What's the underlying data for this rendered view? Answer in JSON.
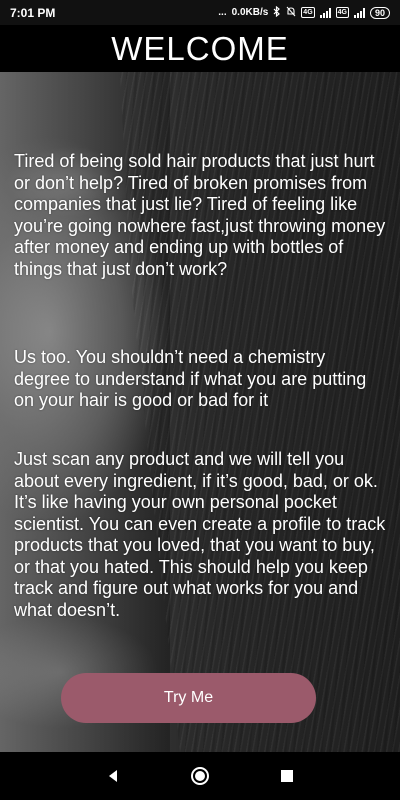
{
  "status_bar": {
    "time": "7:01 PM",
    "dots": "...",
    "network_speed": "0.0KB/s",
    "battery": "90",
    "icons": [
      "bluetooth-icon",
      "mute-bell-icon",
      "volte-icon",
      "signal-icon",
      "signal-icon",
      "battery-icon"
    ]
  },
  "header": {
    "title": "WELCOME"
  },
  "main": {
    "paragraphs": [
      "Tired of being sold hair products that just hurt or don’t help? Tired of broken promises from companies that just lie? Tired of feeling like you’re going nowhere fast,just throwing money after money and ending up with bottles of things that just don’t work?",
      "Us too. You shouldn’t need a chemistry degree to understand if what you are putting on your hair is good or bad for it",
      "Just scan any product and we will tell you about every ingredient, if it’s good, bad, or ok. It’s like having your own personal pocket scientist. You can even create a profile to track products that you loved, that you want to buy, or that you hated. This should help you keep track and figure out what works for you and what doesn’t."
    ],
    "try_button_label": "Try Me",
    "button_color": "#9b5a6b"
  },
  "nav_bar": {
    "icons": [
      "back-icon",
      "home-icon",
      "recents-icon"
    ]
  }
}
